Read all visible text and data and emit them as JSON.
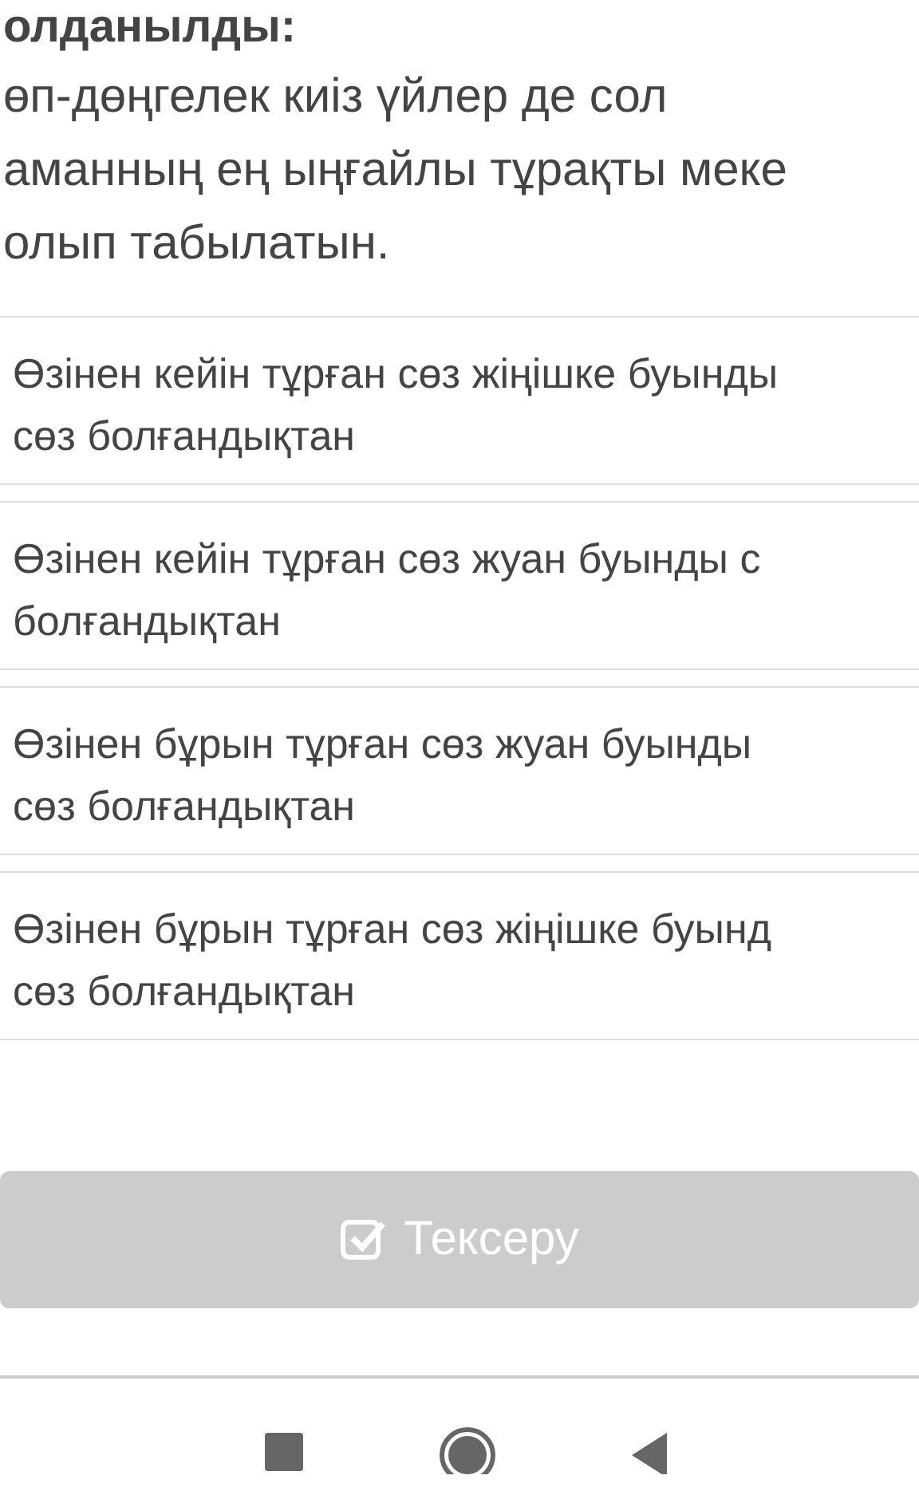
{
  "question": {
    "heading": "олданылды:",
    "lines": [
      "өп-дөңгелек киіз үйлер де сол",
      "аманның ең ыңғайлы тұрақты меке",
      "олып табылатын."
    ]
  },
  "options": [
    {
      "text": "Өзінен кейін тұрған сөз жіңішке буынды\nсөз болғандықтан"
    },
    {
      "text": "Өзінен кейін тұрған сөз жуан буынды с\nболғандықтан"
    },
    {
      "text": "Өзінен бұрын тұрған сөз жуан буынды\nсөз болғандықтан"
    },
    {
      "text": "Өзінен бұрын тұрған сөз жіңішке буынд\nсөз болғандықтан"
    }
  ],
  "check_button": {
    "label": "Тексеру",
    "disabled": true
  }
}
